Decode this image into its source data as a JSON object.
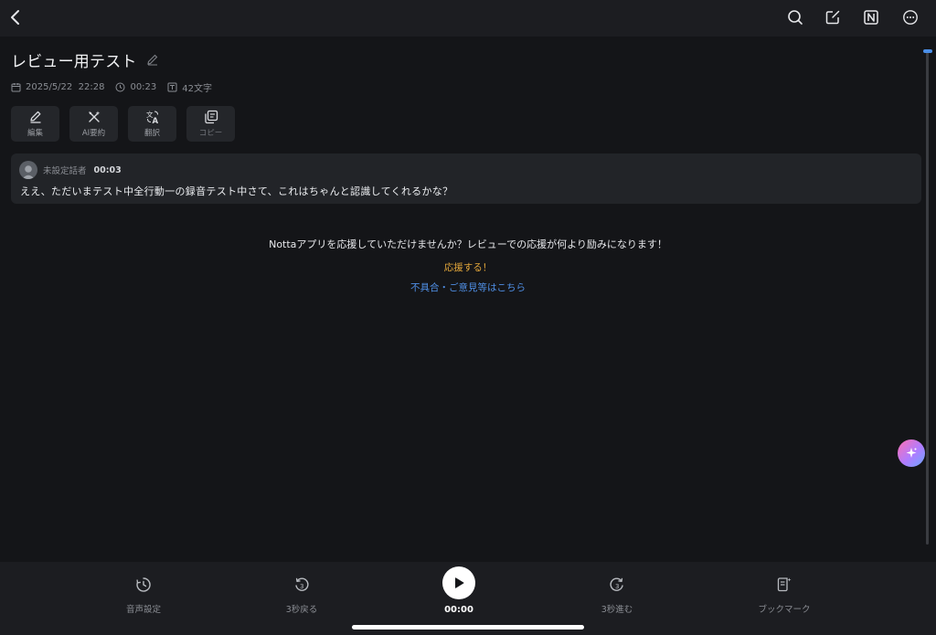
{
  "topbar": {
    "icons": [
      "back-icon",
      "search-icon",
      "share-export-icon",
      "notion-icon",
      "more-icon"
    ]
  },
  "note": {
    "title": "レビュー用テスト",
    "date": "2025/5/22  22:28",
    "duration": "00:23",
    "char_count": "42文字"
  },
  "actions": [
    {
      "label": "編集",
      "icon": "edit-icon"
    },
    {
      "label": "AI要約",
      "icon": "ai-summary-icon"
    },
    {
      "label": "翻訳",
      "icon": "translate-icon"
    },
    {
      "label": "コピー",
      "icon": "copy-icon"
    }
  ],
  "transcript": {
    "speaker": "未設定話者",
    "time": "00:03",
    "text": "ええ、ただいまテスト中全行動一の録音テスト中さて、これはちゃんと認識してくれるかな？"
  },
  "review": {
    "prompt": "Nottaアプリを応援していただけませんか？レビューでの応援が何より励みになります！",
    "cheer_link": "応援する！",
    "feedback_link": "不具合・ご意見等はこちら"
  },
  "player": {
    "audio_settings": "音声設定",
    "rewind": "3秒戻る",
    "time": "00:00",
    "forward": "3秒進む",
    "bookmark": "ブックマーク",
    "rewind_icon_digit": "3",
    "forward_icon_digit": "3"
  },
  "colors": {
    "background": "#141518",
    "bar": "#1c1d21",
    "card": "#222428",
    "accent_orange": "#e2a63a",
    "accent_blue": "#4f8fe6"
  }
}
